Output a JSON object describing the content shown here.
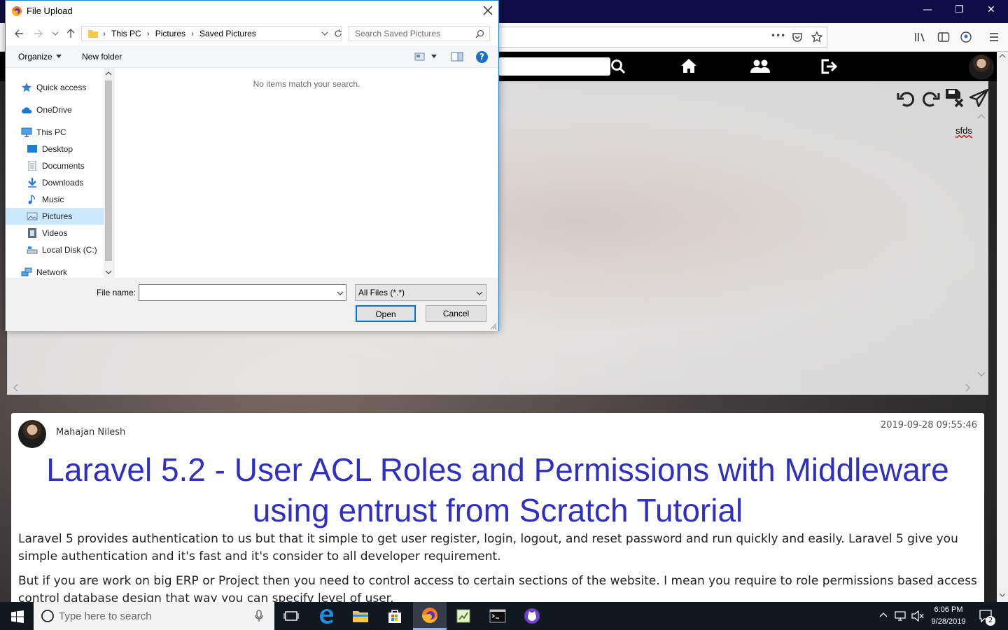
{
  "browser": {
    "url_menu_dots": "•••",
    "window_buttons": {
      "minimize": "—",
      "restore": "❐",
      "close": "✕"
    }
  },
  "site": {
    "editor_text": "sfds",
    "post": {
      "author": "Mahajan Nilesh",
      "date": "2019-09-28 09:55:46",
      "title": "Laravel 5.2 - User ACL Roles and Permissions with Middleware using entrust from Scratch Tutorial",
      "paragraphs": [
        "Laravel 5 provides authentication to us but that it simple to get user register, login, logout, and reset password and run quickly and easily. Laravel 5 give you simple authentication and it's fast and it's consider to all developer requirement.",
        "But if you are work on big ERP or Project then you need to control access to certain sections of the website. I mean you require to role permissions based access control database design that way you can specify level of user."
      ]
    }
  },
  "dialog": {
    "title": "File Upload",
    "path": [
      "This PC",
      "Pictures",
      "Saved Pictures"
    ],
    "search_placeholder": "Search Saved Pictures",
    "organize_label": "Organize",
    "new_folder_label": "New folder",
    "empty_message": "No items match your search.",
    "nav_items": [
      {
        "label": "Quick access",
        "icon": "star-icon"
      },
      {
        "label": "OneDrive",
        "icon": "cloud-icon"
      },
      {
        "label": "This PC",
        "icon": "computer-icon"
      },
      {
        "label": "Desktop",
        "icon": "desktop-icon"
      },
      {
        "label": "Documents",
        "icon": "documents-icon"
      },
      {
        "label": "Downloads",
        "icon": "download-icon"
      },
      {
        "label": "Music",
        "icon": "music-icon"
      },
      {
        "label": "Pictures",
        "icon": "pictures-icon",
        "selected": true
      },
      {
        "label": "Videos",
        "icon": "videos-icon"
      },
      {
        "label": "Local Disk (C:)",
        "icon": "disk-icon"
      },
      {
        "label": "Network",
        "icon": "network-icon"
      }
    ],
    "file_name_label": "File name:",
    "file_name_value": "",
    "file_type": "All Files (*.*)",
    "open_label": "Open",
    "cancel_label": "Cancel",
    "help_label": "?"
  },
  "taskbar": {
    "search_placeholder": "Type here to search",
    "time": "6:06 PM",
    "date": "9/28/2019",
    "notification_count": "2"
  },
  "colors": {
    "title_blue": "#3030c0",
    "dialog_border": "#1883d7",
    "browser_titlebar": "#0e0e46",
    "taskbar": "#101820"
  }
}
